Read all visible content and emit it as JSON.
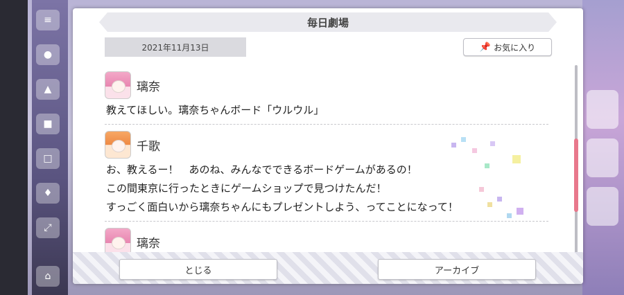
{
  "modal": {
    "title": "毎日劇場",
    "date": "2021年11月13日",
    "favorite_label": "お気に入り",
    "favorite_icon": "pin-icon"
  },
  "dialogue": [
    {
      "speaker": "璃奈",
      "lines": [
        "教えてほしい。璃奈ちゃんボード「ウルウル」"
      ]
    },
    {
      "speaker": "千歌",
      "lines": [
        "お、教えるー！　あのね、みんなでできるボードゲームがあるの！",
        "この間東京に行ったときにゲームショップで見つけたんだ！",
        "すっごく面白いから璃奈ちゃんにもプレゼントしよう、ってことになって！"
      ]
    },
    {
      "speaker": "璃奈",
      "lines": []
    }
  ],
  "scroll": {
    "position_fraction": 0.52
  },
  "footer": {
    "close_label": "とじる",
    "archive_label": "アーカイブ"
  },
  "colors": {
    "accent": "#e8788c",
    "title_bar": "#e9e9ee",
    "date_box": "#dadadf"
  }
}
